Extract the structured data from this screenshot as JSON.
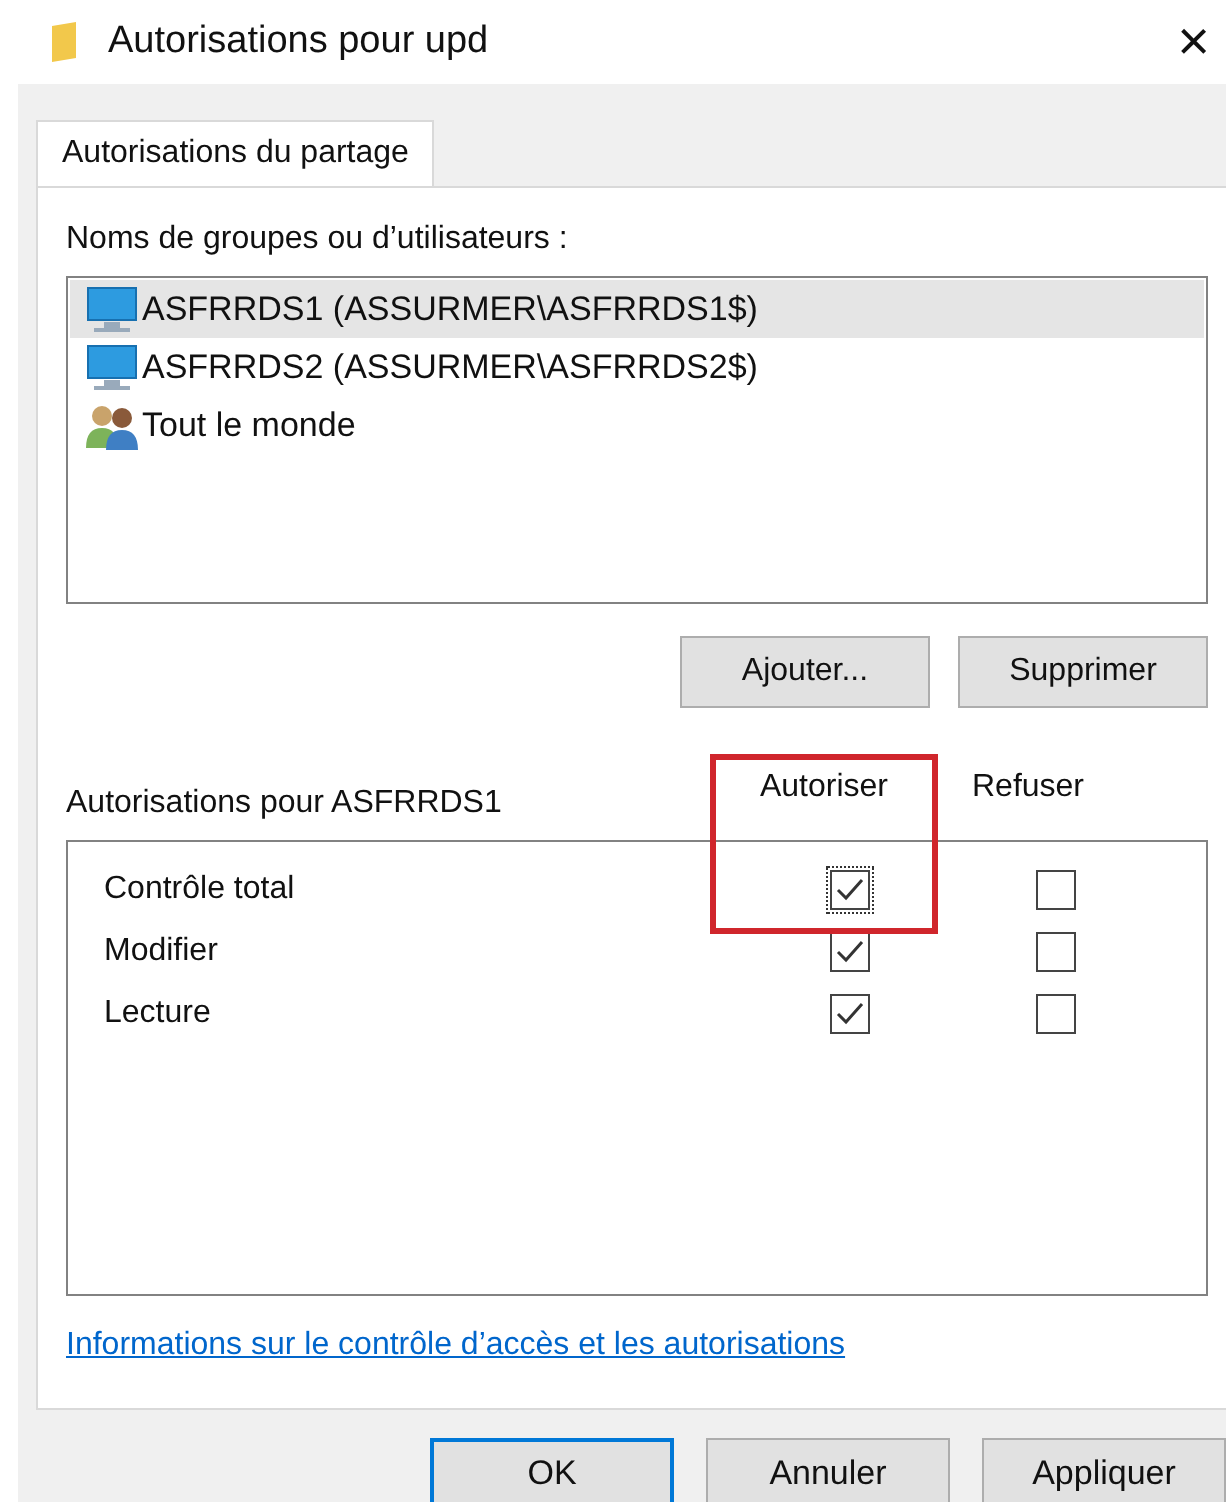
{
  "window": {
    "title": "Autorisations pour upd",
    "close": "×"
  },
  "tabs": [
    {
      "label": "Autorisations du partage",
      "selected": true
    }
  ],
  "users_label": "Noms de groupes ou d’utilisateurs :",
  "users": [
    {
      "kind": "computer",
      "name": "ASFRRDS1 (ASSURMER\\ASFRRDS1$)",
      "selected": true
    },
    {
      "kind": "computer",
      "name": "ASFRRDS2 (ASSURMER\\ASFRRDS2$)",
      "selected": false
    },
    {
      "kind": "group",
      "name": "Tout le monde",
      "selected": false
    }
  ],
  "user_buttons": [
    "Ajouter...",
    "Supprimer"
  ],
  "permissions_label": "Autorisations pour ASFRRDS1",
  "columns": [
    "Autoriser",
    "Refuser"
  ],
  "permissions": [
    {
      "name": "Contrôle total",
      "allow": true,
      "deny": false,
      "focused": true
    },
    {
      "name": "Modifier",
      "allow": true,
      "deny": false,
      "focused": false
    },
    {
      "name": "Lecture",
      "allow": true,
      "deny": false,
      "focused": false
    }
  ],
  "link": "Informations sur le contrôle d’accès et les autorisations",
  "buttons": [
    {
      "label": "OK",
      "default": true
    },
    {
      "label": "Annuler",
      "default": false
    },
    {
      "label": "Appliquer",
      "default": false
    }
  ]
}
